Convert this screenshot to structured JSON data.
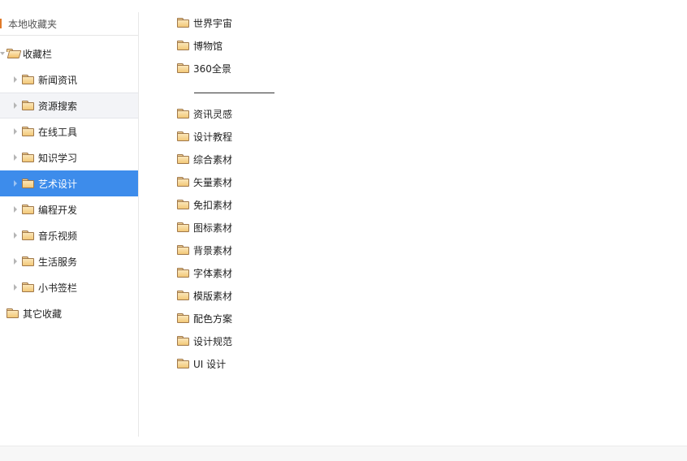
{
  "sidebar": {
    "header": "本地收藏夹",
    "root": "收藏栏",
    "items": [
      {
        "label": "新闻资讯"
      },
      {
        "label": "资源搜索"
      },
      {
        "label": "在线工具"
      },
      {
        "label": "知识学习"
      },
      {
        "label": "艺术设计"
      },
      {
        "label": "编程开发"
      },
      {
        "label": "音乐视频"
      },
      {
        "label": "生活服务"
      },
      {
        "label": "小书签栏"
      }
    ],
    "other": "其它收藏",
    "selected": "艺术设计",
    "hovered": "资源搜索"
  },
  "content": {
    "top_items": [
      {
        "label": "世界宇宙"
      },
      {
        "label": "博物馆"
      },
      {
        "label": "360全景"
      }
    ],
    "separator_text": "——————————",
    "items": [
      {
        "label": "资讯灵感"
      },
      {
        "label": "设计教程"
      },
      {
        "label": "综合素材"
      },
      {
        "label": "矢量素材"
      },
      {
        "label": "免扣素材"
      },
      {
        "label": "图标素材"
      },
      {
        "label": "背景素材"
      },
      {
        "label": "字体素材"
      },
      {
        "label": "模版素材"
      },
      {
        "label": "配色方案"
      },
      {
        "label": "设计规范"
      },
      {
        "label": "UI 设计"
      }
    ]
  },
  "colors": {
    "selection": "#3d8ceb",
    "accent": "#e07a2a"
  }
}
